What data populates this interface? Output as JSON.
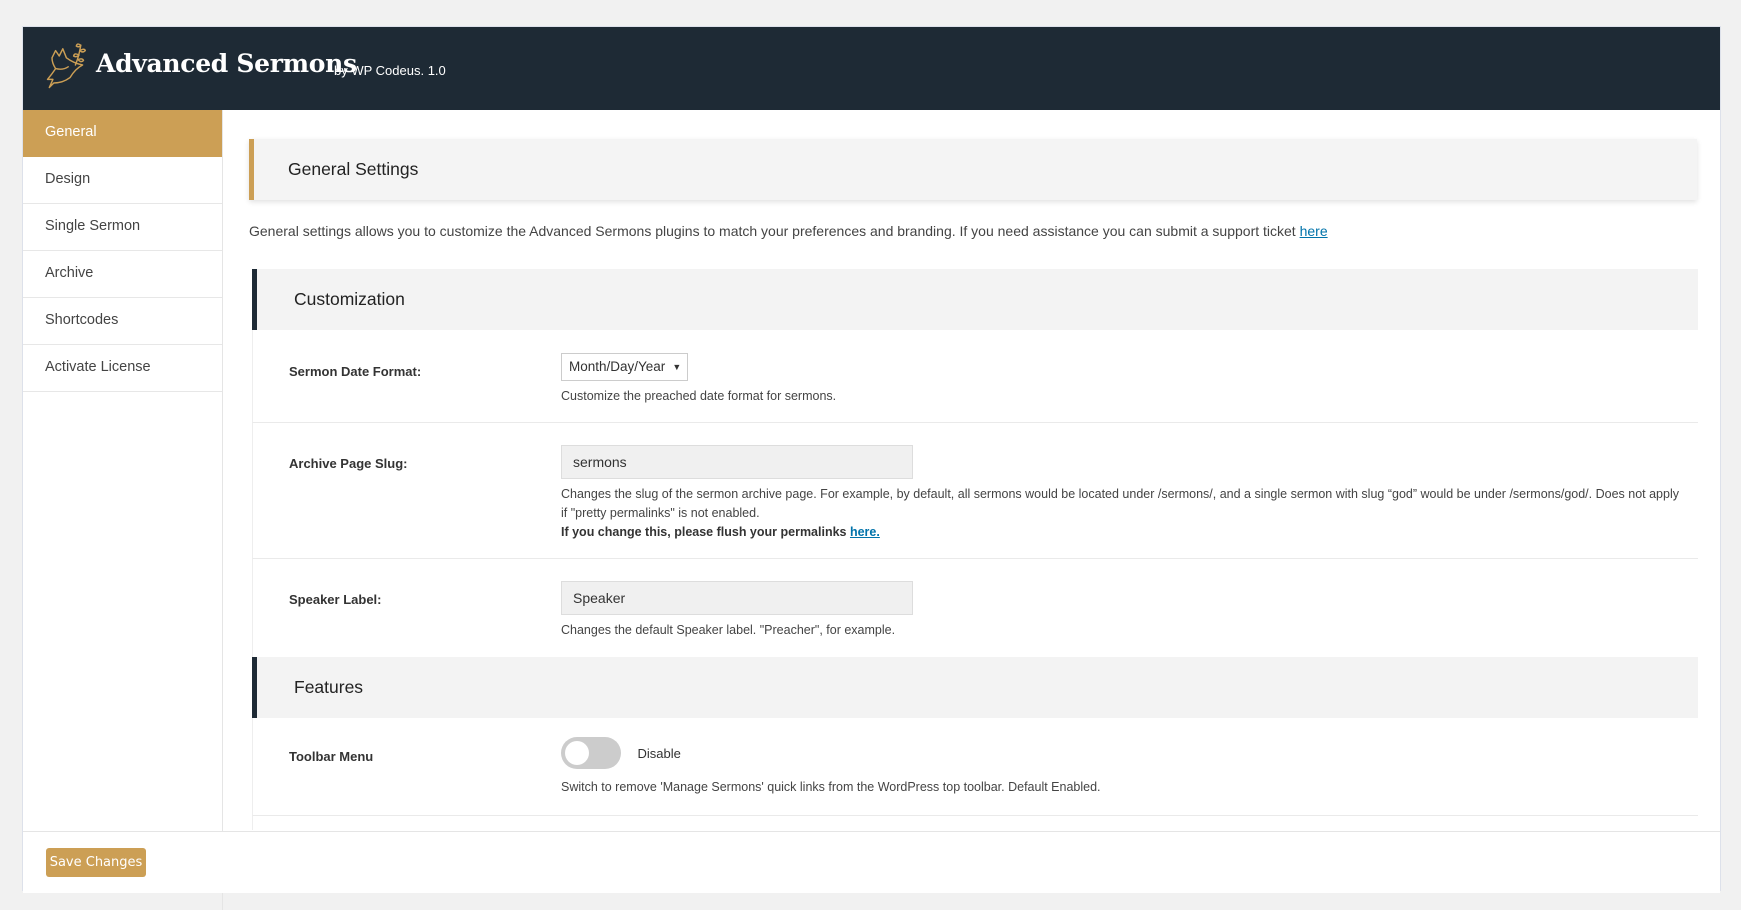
{
  "header": {
    "logo_icon": "dove-with-olive-branch-icon",
    "title": "Advanced Sermons",
    "byline": "by WP Codeus. 1.0"
  },
  "sidebar": {
    "items": [
      {
        "label": "General",
        "active": true
      },
      {
        "label": "Design"
      },
      {
        "label": "Single Sermon"
      },
      {
        "label": "Archive"
      },
      {
        "label": "Shortcodes"
      },
      {
        "label": "Activate License"
      }
    ]
  },
  "page": {
    "title": "General Settings",
    "intro": "General settings allows you to customize the Advanced Sermons plugins to match your preferences and branding. If you need assistance you can submit a support ticket ",
    "intro_link": "here"
  },
  "sections": {
    "customization": {
      "title": "Customization",
      "date_format": {
        "label": "Sermon Date Format:",
        "value": "Month/Day/Year",
        "help": "Customize the preached date format for sermons."
      },
      "archive_slug": {
        "label": "Archive Page Slug:",
        "value": "sermons",
        "help": "Changes the slug of the sermon archive page. For example, by default, all sermons would be located under /sermons/, and a single sermon with slug “god” would be under /sermons/god/. Does not apply if \"pretty permalinks\" is not enabled.",
        "flush_note": "If you change this, please flush your permalinks ",
        "flush_link": "here."
      },
      "speaker_label": {
        "label": "Speaker Label:",
        "value": "Speaker",
        "help": "Changes the default Speaker label. \"Preacher\", for example."
      }
    },
    "features": {
      "title": "Features",
      "toolbar_menu": {
        "label": "Toolbar Menu",
        "state": "Disable",
        "enabled": false,
        "help": "Switch to remove 'Manage Sermons' quick links from the WordPress top toolbar. Default Enabled."
      }
    }
  },
  "footer": {
    "save_label": "Save Changes"
  },
  "colors": {
    "accent": "#cc9f55",
    "header_bg": "#1e2a35",
    "link": "#0073aa"
  }
}
